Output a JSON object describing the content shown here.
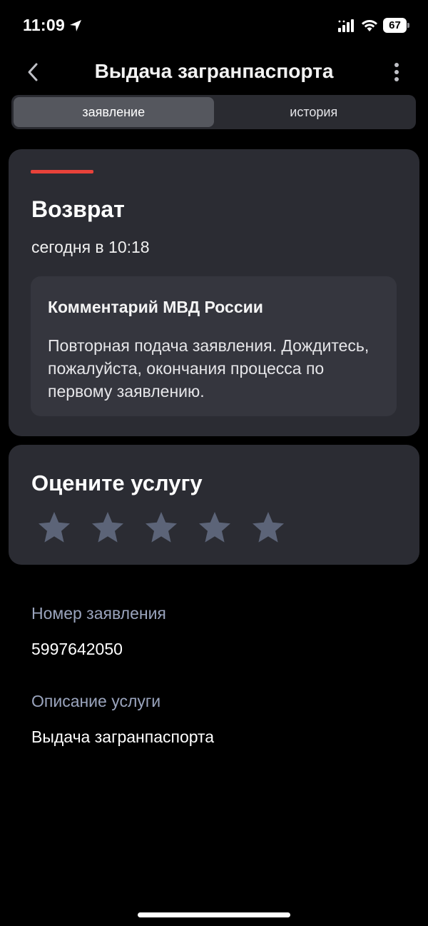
{
  "status_bar": {
    "time": "11:09",
    "battery": "67"
  },
  "header": {
    "title": "Выдача загранпаспорта",
    "back_icon": "chevron-left-icon",
    "more_icon": "vertical-dots-icon"
  },
  "tabs": [
    {
      "label": "заявление",
      "active": true
    },
    {
      "label": "история",
      "active": false
    }
  ],
  "status_card": {
    "title": "Возврат",
    "date": "сегодня в 10:18",
    "accent_color": "#e8423a",
    "comment": {
      "title": "Комментарий МВД России",
      "text": "Повторная подача заявления. Дождитесь, пожалуйста, окончания процесса по первому заявлению."
    }
  },
  "rating_card": {
    "title": "Оцените услугу",
    "stars_total": 5,
    "stars_selected": 0
  },
  "info": {
    "number_label": "Номер заявления",
    "number_value": "5997642050",
    "description_label": "Описание услуги",
    "description_value": "Выдача загранпаспорта"
  }
}
